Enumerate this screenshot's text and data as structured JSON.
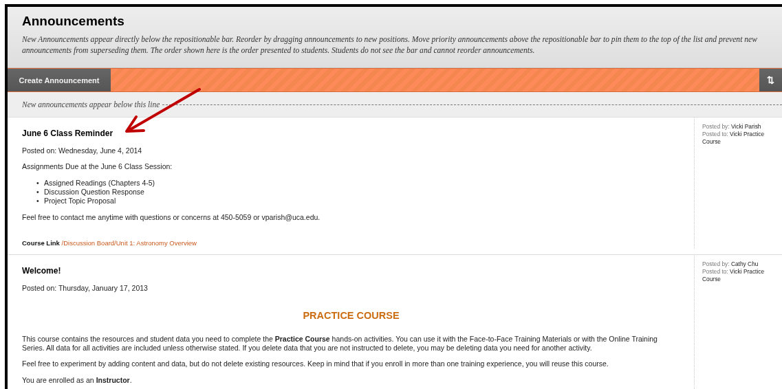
{
  "page": {
    "title": "Announcements",
    "description": "New Announcements appear directly below the repositionable bar. Reorder by dragging announcements to new positions. Move priority announcements above the repositionable bar to pin them to the top of the list and prevent new announcements from superseding them. The order shown here is the order presented to students. Students do not see the bar and cannot reorder announcements."
  },
  "toolbar": {
    "create_button": "Create Announcement",
    "sort_button": "⇅"
  },
  "divider_note": "New announcements appear below this line",
  "announcements": [
    {
      "title": "June 6 Class Reminder",
      "posted_on": "Posted on: Wednesday, June 4, 2014",
      "posted_by_label": "Posted by:",
      "posted_by": "Vicki Parish",
      "posted_to_label": "Posted to:",
      "posted_to": "Vicki Practice Course",
      "blocks": [
        {
          "kind": "paragraph",
          "text": "Assignments Due at the June 6 Class Session:"
        },
        {
          "kind": "list",
          "bullet": "•",
          "items": [
            "Assigned Readings (Chapters 4-5)",
            "Discussion Question Response",
            "Project Topic Proposal"
          ]
        },
        {
          "kind": "paragraph",
          "text": "Feel free to contact me anytime with questions or concerns at 450-5059 or vparish@uca.edu."
        },
        {
          "kind": "course_link",
          "label": "Course Link",
          "link": "/Discussion Board/Unit 1: Astronomy Overview"
        }
      ]
    },
    {
      "title": "Welcome!",
      "posted_on": "Posted on: Thursday, January 17, 2013",
      "posted_by_label": "Posted by:",
      "posted_by": "Cathy Chu",
      "posted_to_label": "Posted to:",
      "posted_to": "Vicki Practice Course",
      "blocks": [
        {
          "kind": "heading",
          "text": "PRACTICE COURSE"
        },
        {
          "kind": "paragraph",
          "text": "This course contains the resources and student data you need to complete the **Practice Course** hands-on activities. You can use it with the Face-to-Face Training Materials or with the Online Training Series. All data for all activities are included unless otherwise stated. If you delete data that you are not instructed to delete, you may be deleting data you need for another activity."
        },
        {
          "kind": "paragraph",
          "text": "Feel free to experiment by adding content and data, but do not delete existing resources. Keep in mind that if you enroll in more than one training experience, you will reuse this course."
        },
        {
          "kind": "paragraph",
          "text": "You are enrolled as an **Instructor**."
        }
      ]
    }
  ]
}
